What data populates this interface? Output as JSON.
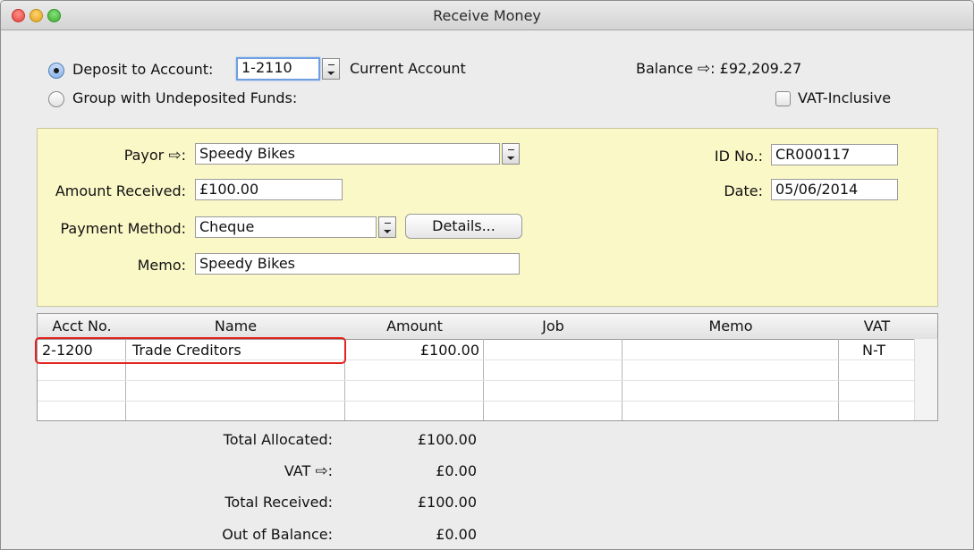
{
  "window": {
    "title": "Receive Money"
  },
  "deposit": {
    "label": "Deposit to Account:",
    "account_no": "1-2110",
    "account_name": "Current Account",
    "group_label": "Group with Undeposited Funds:",
    "balance_label": "Balance",
    "balance_value": "£92,209.27",
    "vat_inclusive_label": "VAT-Inclusive"
  },
  "form": {
    "payor_label": "Payor",
    "payor_value": "Speedy Bikes",
    "amount_label": "Amount Received:",
    "amount_value": "£100.00",
    "method_label": "Payment Method:",
    "method_value": "Cheque",
    "details_label": "Details...",
    "memo_label": "Memo:",
    "memo_value": "Speedy Bikes",
    "id_label": "ID No.:",
    "id_value": "CR000117",
    "date_label": "Date:",
    "date_value": "05/06/2014"
  },
  "table": {
    "columns": [
      "Acct No.",
      "Name",
      "Amount",
      "Job",
      "Memo",
      "VAT"
    ],
    "rows": [
      {
        "acct": "2-1200",
        "name": "Trade Creditors",
        "amount": "£100.00",
        "job": "",
        "memo": "",
        "vat": "N-T"
      }
    ]
  },
  "totals": {
    "allocated_label": "Total Allocated:",
    "allocated_value": "£100.00",
    "vat_label": "VAT",
    "vat_value": "£0.00",
    "received_label": "Total Received:",
    "received_value": "£100.00",
    "out_label": "Out of Balance:",
    "out_value": "£0.00"
  },
  "colors": {
    "panel_bg": "#fbf8c8",
    "highlight": "#e2231f",
    "focus": "#6f9fe0"
  },
  "icons": {
    "zoom_arrow": "right-arrow-icon",
    "lookup": "list-lookup-icon"
  }
}
